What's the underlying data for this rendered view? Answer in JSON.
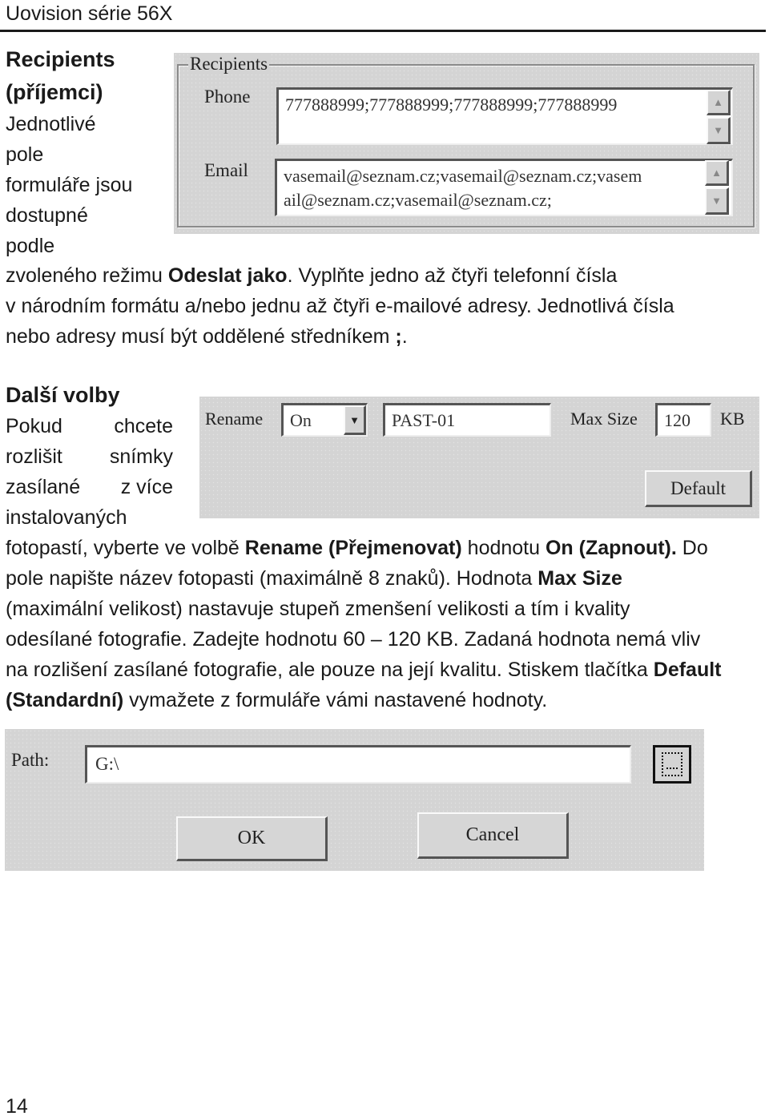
{
  "header": {
    "title": "Uovision série 56X"
  },
  "section_recipients": {
    "heading_line1": "Recipients",
    "heading_line2": "(příjemci)",
    "side_lines": [
      "Jednotlivé",
      "pole",
      "formuláře jsou",
      "dostupné",
      "podle"
    ],
    "para_line1_a": "zvoleného režimu ",
    "para_line1_bold": "Odeslat jako",
    "para_line1_b": ". Vyplňte jedno až čtyři telefonní čísla",
    "para_line2": "v národním formátu a/nebo jednu až čtyři e-mailové adresy. Jednotlivá čísla",
    "para_line3_a": "nebo adresy musí být oddělené středníkem ",
    "para_line3_bold": ";",
    "para_line3_b": "."
  },
  "recipients_dialog": {
    "group_label": "Recipients",
    "phone_label": "Phone",
    "phone_value": "777888999;777888999;777888999;777888999",
    "email_label": "Email",
    "email_value_line1": "vasemail@seznam.cz;vasemail@seznam.cz;vasem",
    "email_value_line2": "ail@seznam.cz;vasemail@seznam.cz;",
    "scroll_up_icon": "▲",
    "scroll_down_icon": "▼"
  },
  "section_options": {
    "heading": "Další volby",
    "side_lines": [
      [
        "Pokud",
        "chcete"
      ],
      [
        "rozlišit",
        "snímky"
      ],
      [
        "zasílané",
        "z více"
      ]
    ],
    "side_line4": "instalovaných",
    "p1_a": "fotopastí, vyberte ve volbě ",
    "p1_bold1": "Rename (Přejmenovat)",
    "p1_b": " hodnotu ",
    "p1_bold2": "On (Zapnout).",
    "p1_c": " Do",
    "p2_a": "pole napište název fotopasti (maximálně 8 znaků). Hodnota ",
    "p2_bold": "Max Size",
    "p3": "(maximální velikost) nastavuje stupeň zmenšení velikosti a tím i kvality",
    "p4": "odesílané fotografie. Zadejte hodnotu 60 – 120 KB. Zadaná hodnota nemá vliv",
    "p5_a": "na rozlišení zasílané fotografie, ale pouze na její kvalitu. Stiskem tlačítka ",
    "p5_bold": "Default",
    "p6_bold": "(Standardní)",
    "p6_b": " vymažete z formuláře vámi nastavené hodnoty."
  },
  "options_dialog": {
    "rename_label": "Rename",
    "rename_selected": "On",
    "dropdown_icon": "▼",
    "name_value": "PAST-01",
    "max_size_label": "Max Size",
    "max_size_value": "120",
    "unit_label": "KB",
    "default_button": "Default"
  },
  "path_dialog": {
    "path_label": "Path:",
    "path_value": "G:\\",
    "ok_button": "OK",
    "cancel_button": "Cancel"
  },
  "footer": {
    "page_number": "14"
  }
}
